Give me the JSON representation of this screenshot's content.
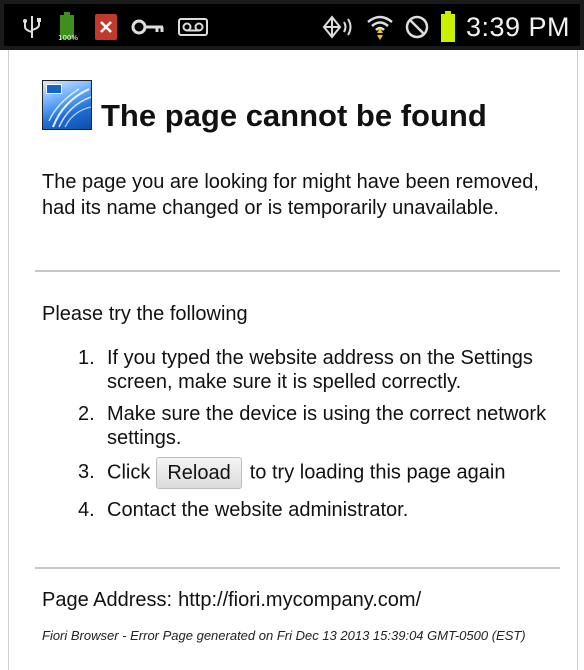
{
  "status_bar": {
    "time": "3:39 PM",
    "battery_small_label": "100%",
    "icons": [
      "usb-icon",
      "battery-full-icon",
      "close-notification-icon",
      "key-icon",
      "voicemail-icon",
      "nfc-icon",
      "wifi-icon",
      "no-disturb-icon",
      "battery-icon"
    ],
    "battery_color": "#c8f000"
  },
  "page": {
    "title": "The page cannot be found",
    "description": "The page you are looking for might have been removed, had its name changed or is temporarily unavailable.",
    "try_heading": "Please try the following",
    "steps": [
      {
        "number": "1.",
        "text": "If you typed the website address on the Settings screen, make sure it is spelled correctly."
      },
      {
        "number": "2.",
        "text": "Make sure the device is using the correct network settings."
      },
      {
        "number": "3.",
        "prefix": "Click",
        "button": "Reload",
        "suffix": "to try loading this page again"
      },
      {
        "number": "4.",
        "text": "Contact the website administrator."
      }
    ],
    "address_label": "Page Address:",
    "address_value": "http://fiori.mycompany.com/",
    "footer": "Fiori Browser - Error Page generated on Fri Dec 13 2013 15:39:04 GMT-0500 (EST)"
  }
}
